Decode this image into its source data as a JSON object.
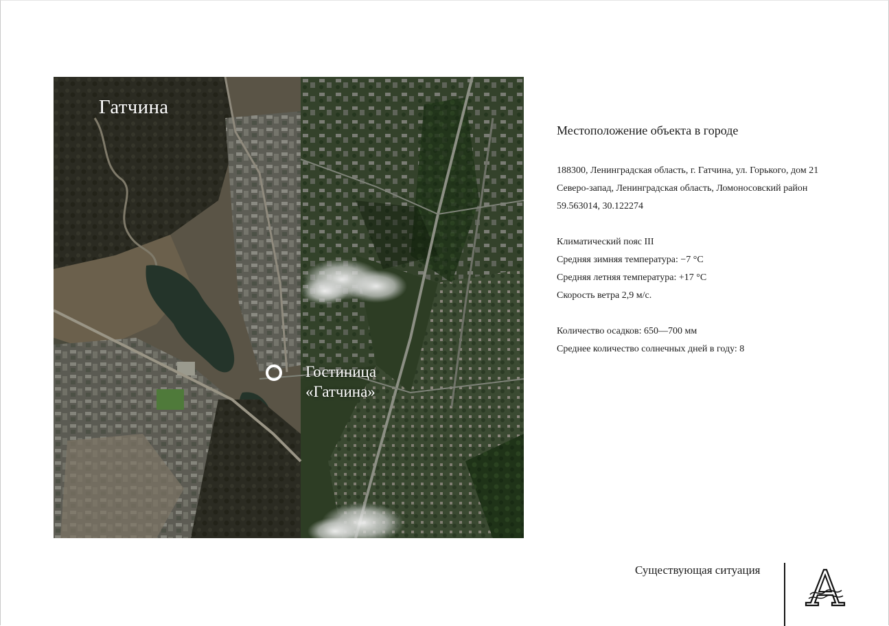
{
  "map": {
    "city_label": "Гатчина",
    "hotel_label_line1": "Гостиница",
    "hotel_label_line2": "«Гатчина»",
    "marker_icon": "location-ring-icon"
  },
  "info": {
    "title": "Местоположение объекта в городе",
    "address": "188300, Ленинградская область, г. Гатчина, ул. Горького, дом 21",
    "region": "Северо-запад, Ленинградская область, Ломоносовский район",
    "coordinates": "59.563014, 30.122274",
    "climate_zone": "Климатический пояс III",
    "winter_temp": "Средняя зимняя температура: −7 °С",
    "summer_temp": "Средняя летняя температура: +17 °С",
    "wind_speed": "Скорость ветра 2,9 м/с.",
    "precipitation": "Количество осадков: 650—700 мм",
    "sunny_days": "Среднее количество солнечных дней в году: 8"
  },
  "footer": {
    "caption": "Существующая ситуация",
    "logo_icon": "letter-a-logo-icon"
  }
}
